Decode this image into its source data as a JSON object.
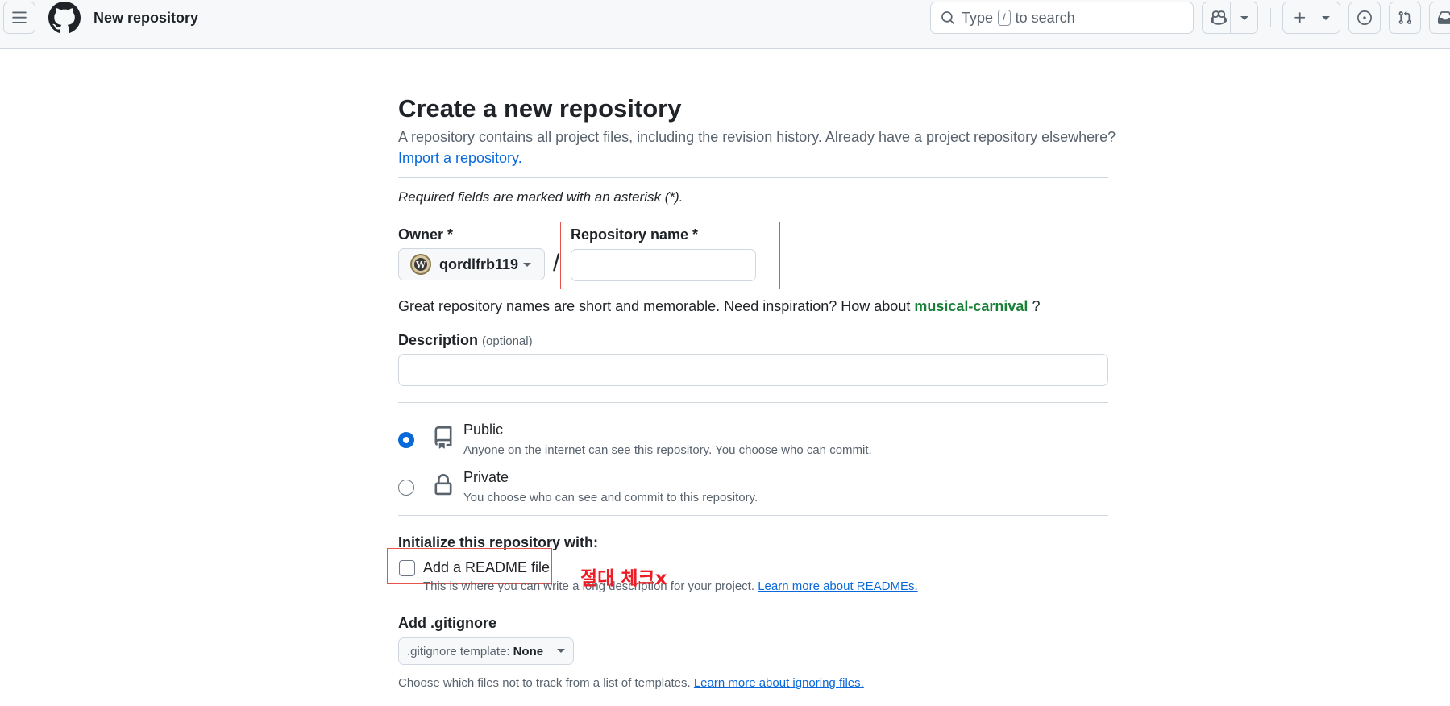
{
  "header": {
    "context_title": "New repository",
    "search": {
      "prefix": "Type",
      "shortcut_key": "/",
      "suffix": "to search"
    }
  },
  "page": {
    "title": "Create a new repository",
    "subtitle": "A repository contains all project files, including the revision history. Already have a project repository elsewhere?",
    "import_link": "Import a repository.",
    "required_note": "Required fields are marked with an asterisk (*).",
    "owner": {
      "label": "Owner *",
      "value": "qordlfrb119"
    },
    "slash": "/",
    "repo_name": {
      "label": "Repository name *",
      "value": ""
    },
    "name_hint": {
      "prefix": "Great repository names are short and memorable. Need inspiration? How about",
      "suggestion": "musical-carnival",
      "suffix": "?"
    },
    "description": {
      "label": "Description",
      "optional": "(optional)",
      "value": ""
    },
    "visibility": [
      {
        "title": "Public",
        "description": "Anyone on the internet can see this repository. You choose who can commit.",
        "selected": true,
        "icon": "repo-icon"
      },
      {
        "title": "Private",
        "description": "You choose who can see and commit to this repository.",
        "selected": false,
        "icon": "lock-icon"
      }
    ],
    "initialize": {
      "label": "Initialize this repository with:",
      "readme_label": "Add a README file",
      "readme_checked": false,
      "readme_desc": "This is where you can write a long description for your project.",
      "readme_link": "Learn more about READMEs."
    },
    "annotation": "절대 체크x",
    "gitignore": {
      "label": "Add .gitignore",
      "button_prefix": ".gitignore template:",
      "button_value": "None",
      "desc": "Choose which files not to track from a list of templates.",
      "link": "Learn more about ignoring files."
    }
  },
  "colors": {
    "accent": "#0969da",
    "suggestion": "#1a7f37",
    "annotation": "#ee1c25"
  }
}
